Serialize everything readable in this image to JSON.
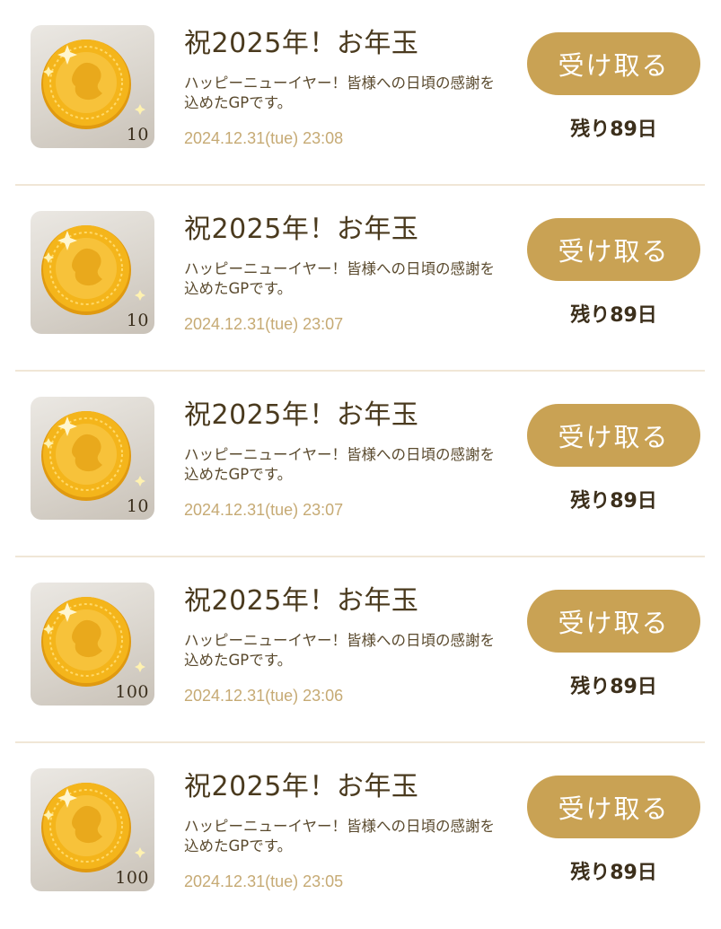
{
  "colors": {
    "button_bg": "#c9a254",
    "button_text": "#ffffff",
    "date_text": "#c6aa74",
    "divider": "#f0e6d6",
    "coin": "#f2b51c"
  },
  "items": [
    {
      "icon": "gold-coin-icon",
      "amount": "10",
      "title": "祝2025年！お年玉",
      "description": "ハッピーニューイヤー！皆様への日頃の感謝を込めたGPです。",
      "date": "2024.12.31(tue) 23:08",
      "button_label": "受け取る",
      "remaining": "残り89日"
    },
    {
      "icon": "gold-coin-icon",
      "amount": "10",
      "title": "祝2025年！お年玉",
      "description": "ハッピーニューイヤー！皆様への日頃の感謝を込めたGPです。",
      "date": "2024.12.31(tue) 23:07",
      "button_label": "受け取る",
      "remaining": "残り89日"
    },
    {
      "icon": "gold-coin-icon",
      "amount": "10",
      "title": "祝2025年！お年玉",
      "description": "ハッピーニューイヤー！皆様への日頃の感謝を込めたGPです。",
      "date": "2024.12.31(tue) 23:07",
      "button_label": "受け取る",
      "remaining": "残り89日"
    },
    {
      "icon": "gold-coin-icon",
      "amount": "100",
      "title": "祝2025年！お年玉",
      "description": "ハッピーニューイヤー！皆様への日頃の感謝を込めたGPです。",
      "date": "2024.12.31(tue) 23:06",
      "button_label": "受け取る",
      "remaining": "残り89日"
    },
    {
      "icon": "gold-coin-icon",
      "amount": "100",
      "title": "祝2025年！お年玉",
      "description": "ハッピーニューイヤー！皆様への日頃の感謝を込めたGPです。",
      "date": "2024.12.31(tue) 23:05",
      "button_label": "受け取る",
      "remaining": "残り89日"
    }
  ]
}
